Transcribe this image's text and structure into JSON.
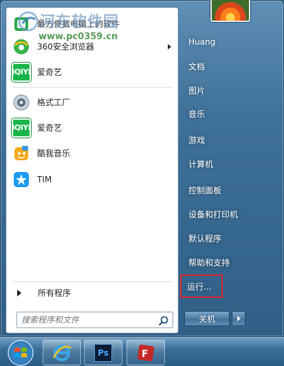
{
  "left_panel": {
    "pinned": [
      {
        "label": "最方便截电脑上的软件",
        "icon": "green-app-icon"
      },
      {
        "label": "360安全浏览器",
        "icon": "360-browser-icon",
        "has_submenu": true
      },
      {
        "label": "爱奇艺",
        "icon": "iqiyi-icon"
      }
    ],
    "recent": [
      {
        "label": "格式工厂",
        "icon": "format-factory-icon"
      },
      {
        "label": "爱奇艺",
        "icon": "iqiyi-icon"
      },
      {
        "label": "酷我音乐",
        "icon": "kuwo-music-icon"
      },
      {
        "label": "TIM",
        "icon": "tim-icon"
      }
    ],
    "iqiyi_text": "iQIYI",
    "all_programs": "所有程序",
    "search_placeholder": "搜索程序和文件"
  },
  "right_panel": {
    "items": [
      {
        "label": "Huang"
      },
      {
        "label": "文档"
      },
      {
        "label": "图片"
      },
      {
        "label": "音乐"
      },
      {
        "label": "游戏"
      },
      {
        "label": "计算机"
      },
      {
        "label": "控制面板"
      },
      {
        "label": "设备和打印机"
      },
      {
        "label": "默认程序"
      },
      {
        "label": "帮助和支持"
      },
      {
        "label": "运行..."
      }
    ],
    "shutdown_label": "关机"
  },
  "taskbar": {
    "apps": [
      {
        "name": "internet-explorer-icon"
      },
      {
        "name": "photoshop-icon",
        "text": "Ps"
      },
      {
        "name": "filezilla-icon"
      }
    ]
  },
  "watermark": {
    "title": "河东软件园",
    "url": "www.pc0359.cn"
  },
  "colors": {
    "highlight_box": "#e0252b",
    "iqiyi_green": "#18b548"
  }
}
